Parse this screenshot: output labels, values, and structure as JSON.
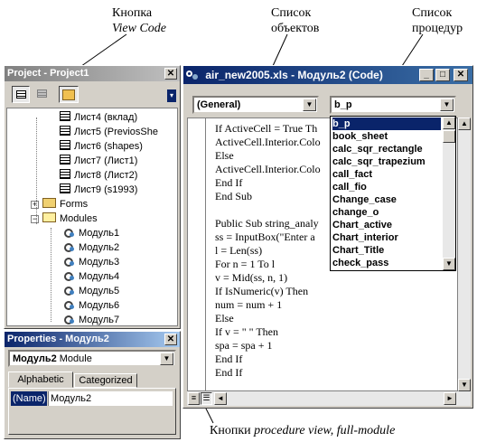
{
  "annotations": {
    "view_code": [
      "Кнопка",
      "View Code"
    ],
    "object_list": [
      "Список",
      "объектов"
    ],
    "procedure_list": [
      "Список",
      "процедур"
    ],
    "bottom": [
      "Кнопки ",
      "procedure view, full-module"
    ]
  },
  "project": {
    "title": "Project - Project1",
    "tree": [
      {
        "label": "Лист4 (вклад)",
        "icon": "sheet"
      },
      {
        "label": "Лист5 (PreviosShe",
        "icon": "sheet"
      },
      {
        "label": "Лист6 (shapes)",
        "icon": "sheet"
      },
      {
        "label": "Лист7 (Лист1)",
        "icon": "sheet"
      },
      {
        "label": "Лист8 (Лист2)",
        "icon": "sheet"
      },
      {
        "label": "Лист9 (s1993)",
        "icon": "sheet"
      },
      {
        "label": "Forms",
        "icon": "folder",
        "expander": "+"
      },
      {
        "label": "Modules",
        "icon": "folder-open",
        "expander": "−"
      },
      {
        "label": "Модуль1",
        "icon": "module"
      },
      {
        "label": "Модуль2",
        "icon": "module"
      },
      {
        "label": "Модуль3",
        "icon": "module"
      },
      {
        "label": "Модуль4",
        "icon": "module"
      },
      {
        "label": "Модуль5",
        "icon": "module"
      },
      {
        "label": "Модуль6",
        "icon": "module"
      },
      {
        "label": "Модуль7",
        "icon": "module"
      }
    ]
  },
  "properties": {
    "title": "Properties - Модуль2",
    "object_name": "Модуль2",
    "object_type": "Module",
    "tabs": [
      "Alphabetic",
      "Categorized"
    ],
    "name_prop": "(Name)",
    "name_value": "Модуль2"
  },
  "code_window": {
    "title": "air_new2005.xls - Модуль2 (Code)",
    "object_combo": "(General)",
    "proc_combo": "b_p",
    "lines": [
      "If ActiveCell = True Th",
      "ActiveCell.Interior.Colo",
      "Else",
      "ActiveCell.Interior.Colo",
      "End If",
      "End Sub",
      "",
      "Public Sub string_analy",
      "ss = InputBox(\"Enter a",
      "l = Len(ss)",
      "For n = 1 To l",
      "v = Mid(ss, n, 1)",
      "If IsNumeric(v) Then",
      "num = num + 1",
      "Else",
      "If v = \" \" Then",
      "spa = spa + 1",
      "End If",
      "End If"
    ],
    "proc_list": [
      "b_p",
      "book_sheet",
      "calc_sqr_rectangle",
      "calc_sqr_trapezium",
      "call_fact",
      "call_fio",
      "Change_case",
      "change_o",
      "Chart_active",
      "Chart_interior",
      "Chart_Title",
      "check_pass"
    ]
  }
}
